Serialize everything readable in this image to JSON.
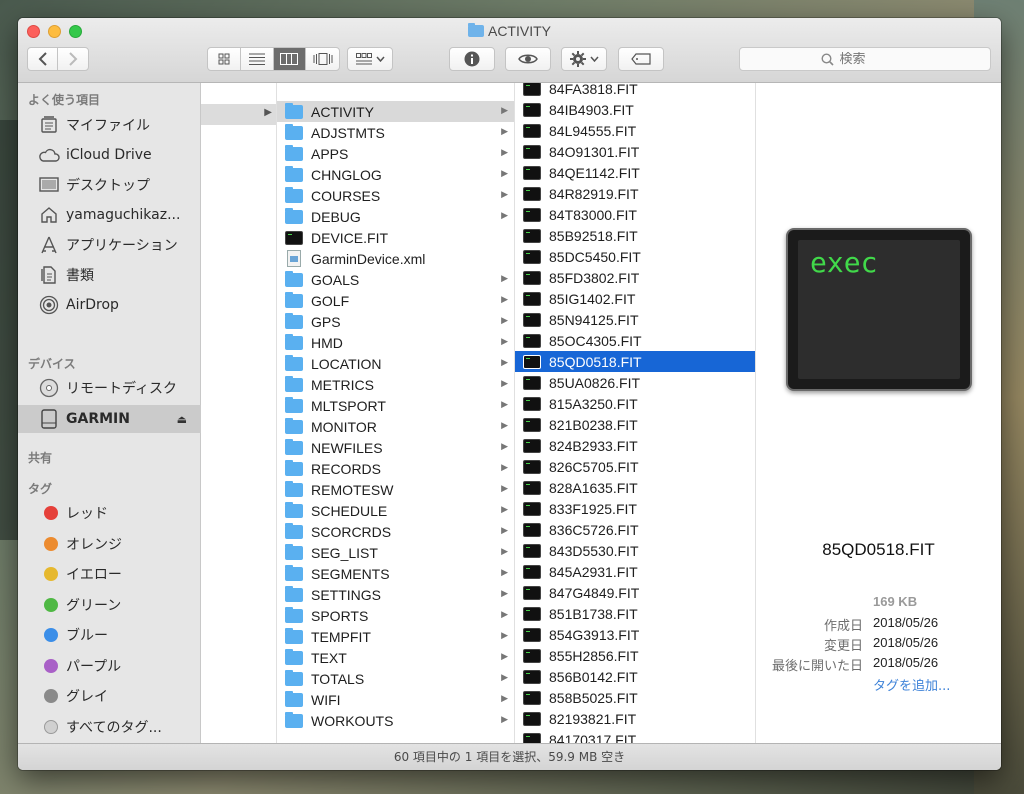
{
  "window": {
    "title": "ACTIVITY"
  },
  "toolbar": {
    "search_placeholder": "検索"
  },
  "sidebar": {
    "favorites_header": "よく使う項目",
    "favorites": [
      {
        "label": "マイファイル",
        "icon": "all-my-files-icon"
      },
      {
        "label": "iCloud Drive",
        "icon": "cloud-icon"
      },
      {
        "label": "デスクトップ",
        "icon": "desktop-icon"
      },
      {
        "label": "yamaguchikaz...",
        "icon": "home-icon"
      },
      {
        "label": "アプリケーション",
        "icon": "applications-icon"
      },
      {
        "label": "書類",
        "icon": "documents-icon"
      },
      {
        "label": "AirDrop",
        "icon": "airdrop-icon"
      }
    ],
    "devices_header": "デバイス",
    "devices": [
      {
        "label": "リモートディスク",
        "icon": "remote-disc-icon"
      },
      {
        "label": "GARMIN",
        "icon": "drive-icon"
      }
    ],
    "shared_header": "共有",
    "tags_header": "タグ",
    "tags": [
      {
        "label": "レッド",
        "color": "#e5403a"
      },
      {
        "label": "オレンジ",
        "color": "#ec8b2f"
      },
      {
        "label": "イエロー",
        "color": "#e6b82e"
      },
      {
        "label": "グリーン",
        "color": "#4fb844"
      },
      {
        "label": "ブルー",
        "color": "#3b8ee8"
      },
      {
        "label": "パープル",
        "color": "#a960c7"
      },
      {
        "label": "グレイ",
        "color": "#8a8a8a"
      },
      {
        "label": "すべてのタグ...",
        "color": "#d0d0d0"
      }
    ]
  },
  "column2": {
    "items": [
      {
        "name": "ACTIVITY",
        "kind": "folder"
      },
      {
        "name": "ADJSTMTS",
        "kind": "folder"
      },
      {
        "name": "APPS",
        "kind": "folder"
      },
      {
        "name": "CHNGLOG",
        "kind": "folder"
      },
      {
        "name": "COURSES",
        "kind": "folder"
      },
      {
        "name": "DEBUG",
        "kind": "folder"
      },
      {
        "name": "DEVICE.FIT",
        "kind": "exec"
      },
      {
        "name": "GarminDevice.xml",
        "kind": "xml"
      },
      {
        "name": "GOALS",
        "kind": "folder"
      },
      {
        "name": "GOLF",
        "kind": "folder"
      },
      {
        "name": "GPS",
        "kind": "folder"
      },
      {
        "name": "HMD",
        "kind": "folder"
      },
      {
        "name": "LOCATION",
        "kind": "folder"
      },
      {
        "name": "METRICS",
        "kind": "folder"
      },
      {
        "name": "MLTSPORT",
        "kind": "folder"
      },
      {
        "name": "MONITOR",
        "kind": "folder"
      },
      {
        "name": "NEWFILES",
        "kind": "folder"
      },
      {
        "name": "RECORDS",
        "kind": "folder"
      },
      {
        "name": "REMOTESW",
        "kind": "folder"
      },
      {
        "name": "SCHEDULE",
        "kind": "folder"
      },
      {
        "name": "SCORCRDS",
        "kind": "folder"
      },
      {
        "name": "SEG_LIST",
        "kind": "folder"
      },
      {
        "name": "SEGMENTS",
        "kind": "folder"
      },
      {
        "name": "SETTINGS",
        "kind": "folder"
      },
      {
        "name": "SPORTS",
        "kind": "folder"
      },
      {
        "name": "TEMPFIT",
        "kind": "folder"
      },
      {
        "name": "TEXT",
        "kind": "folder"
      },
      {
        "name": "TOTALS",
        "kind": "folder"
      },
      {
        "name": "WIFI",
        "kind": "folder"
      },
      {
        "name": "WORKOUTS",
        "kind": "folder"
      }
    ]
  },
  "column3": {
    "items": [
      "84FA3818.FIT",
      "84IB4903.FIT",
      "84L94555.FIT",
      "84O91301.FIT",
      "84QE1142.FIT",
      "84R82919.FIT",
      "84T83000.FIT",
      "85B92518.FIT",
      "85DC5450.FIT",
      "85FD3802.FIT",
      "85IG1402.FIT",
      "85N94125.FIT",
      "85OC4305.FIT",
      "85QD0518.FIT",
      "85UA0826.FIT",
      "815A3250.FIT",
      "821B0238.FIT",
      "824B2933.FIT",
      "826C5705.FIT",
      "828A1635.FIT",
      "833F1925.FIT",
      "836C5726.FIT",
      "843D5530.FIT",
      "845A2931.FIT",
      "847G4849.FIT",
      "851B1738.FIT",
      "854G3913.FIT",
      "855H2856.FIT",
      "856B0142.FIT",
      "858B5025.FIT",
      "82193821.FIT",
      "84170317.FIT"
    ],
    "selected": "85QD0518.FIT"
  },
  "preview": {
    "icon_text": "exec",
    "name": "85QD0518.FIT",
    "size": "169 KB",
    "created_label": "作成日",
    "created": "2018/05/26",
    "modified_label": "変更日",
    "modified": "2018/05/26",
    "opened_label": "最後に開いた日",
    "opened": "2018/05/26",
    "add_tag": "タグを追加..."
  },
  "statusbar": {
    "text": "60 項目中の 1 項目を選択、59.9 MB 空き"
  }
}
